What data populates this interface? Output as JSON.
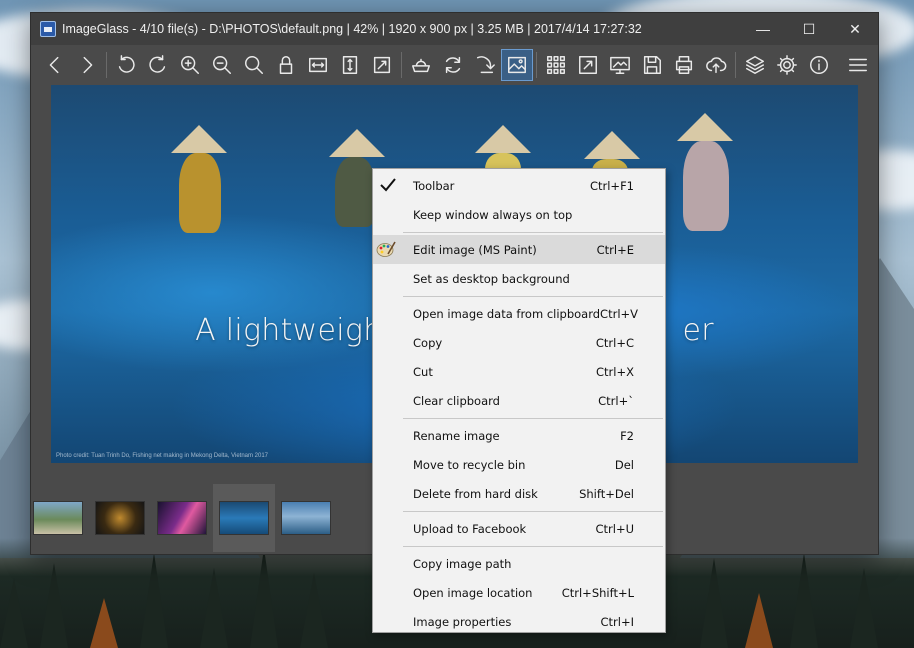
{
  "window": {
    "title": "ImageGlass - 4/10 file(s) - D:\\PHOTOS\\default.png  |  42%  |  1920 x 900 px  |  3.25 MB  |  2017/4/14 17:27:32",
    "min_glyph": "—",
    "max_glyph": "☐",
    "close_glyph": "✕"
  },
  "toolbar": {
    "buttons": [
      "back-icon",
      "forward-icon",
      "rotate-left-icon",
      "rotate-right-icon",
      "zoom-in-icon",
      "zoom-out-icon",
      "actual-size-icon",
      "lock-zoom-icon",
      "fit-width-icon",
      "fit-height-icon",
      "scale-to-fit-icon",
      "open-with-icon",
      "refresh-icon",
      "go-to-image-icon",
      "view-image-icon",
      "thumbnail-grid-icon",
      "fullscreen-icon",
      "slideshow-icon",
      "save-icon",
      "print-icon",
      "upload-icon",
      "plugins-icon",
      "settings-icon",
      "about-icon",
      "menu-icon"
    ],
    "active": "view-image-icon"
  },
  "viewer": {
    "overlay_text_left": "A lightweigh",
    "overlay_text_right": "er",
    "credit": "Photo credit: Tuan Trinh Do, Fishing net making in Mekong Delta, Vietnam 2017"
  },
  "context_menu": {
    "groups": [
      [
        {
          "label": "Toolbar",
          "shortcut": "Ctrl+F1",
          "checked": true
        },
        {
          "label": "Keep window always on top",
          "shortcut": ""
        }
      ],
      [
        {
          "label": "Edit image (MS Paint)",
          "shortcut": "Ctrl+E",
          "icon": "paint-palette-icon",
          "highlighted": true
        },
        {
          "label": "Set as desktop background",
          "shortcut": ""
        }
      ],
      [
        {
          "label": "Open image data from clipboard",
          "shortcut": "Ctrl+V"
        },
        {
          "label": "Copy",
          "shortcut": "Ctrl+C"
        },
        {
          "label": "Cut",
          "shortcut": "Ctrl+X"
        },
        {
          "label": "Clear clipboard",
          "shortcut": "Ctrl+`"
        }
      ],
      [
        {
          "label": "Rename image",
          "shortcut": "F2"
        },
        {
          "label": "Move to recycle bin",
          "shortcut": "Del"
        },
        {
          "label": "Delete from hard disk",
          "shortcut": "Shift+Del"
        }
      ],
      [
        {
          "label": "Upload to Facebook",
          "shortcut": "Ctrl+U"
        }
      ],
      [
        {
          "label": "Copy image path",
          "shortcut": ""
        },
        {
          "label": "Open image location",
          "shortcut": "Ctrl+Shift+L"
        },
        {
          "label": "Image properties",
          "shortcut": "Ctrl+I"
        }
      ]
    ]
  },
  "colors": {
    "window_bg": "#4a4a4a",
    "titlebar_bg": "#3f3f3f",
    "menu_bg": "#f2f2f2",
    "menu_highlight": "#dadada",
    "active_tool": "#3a5f86"
  }
}
